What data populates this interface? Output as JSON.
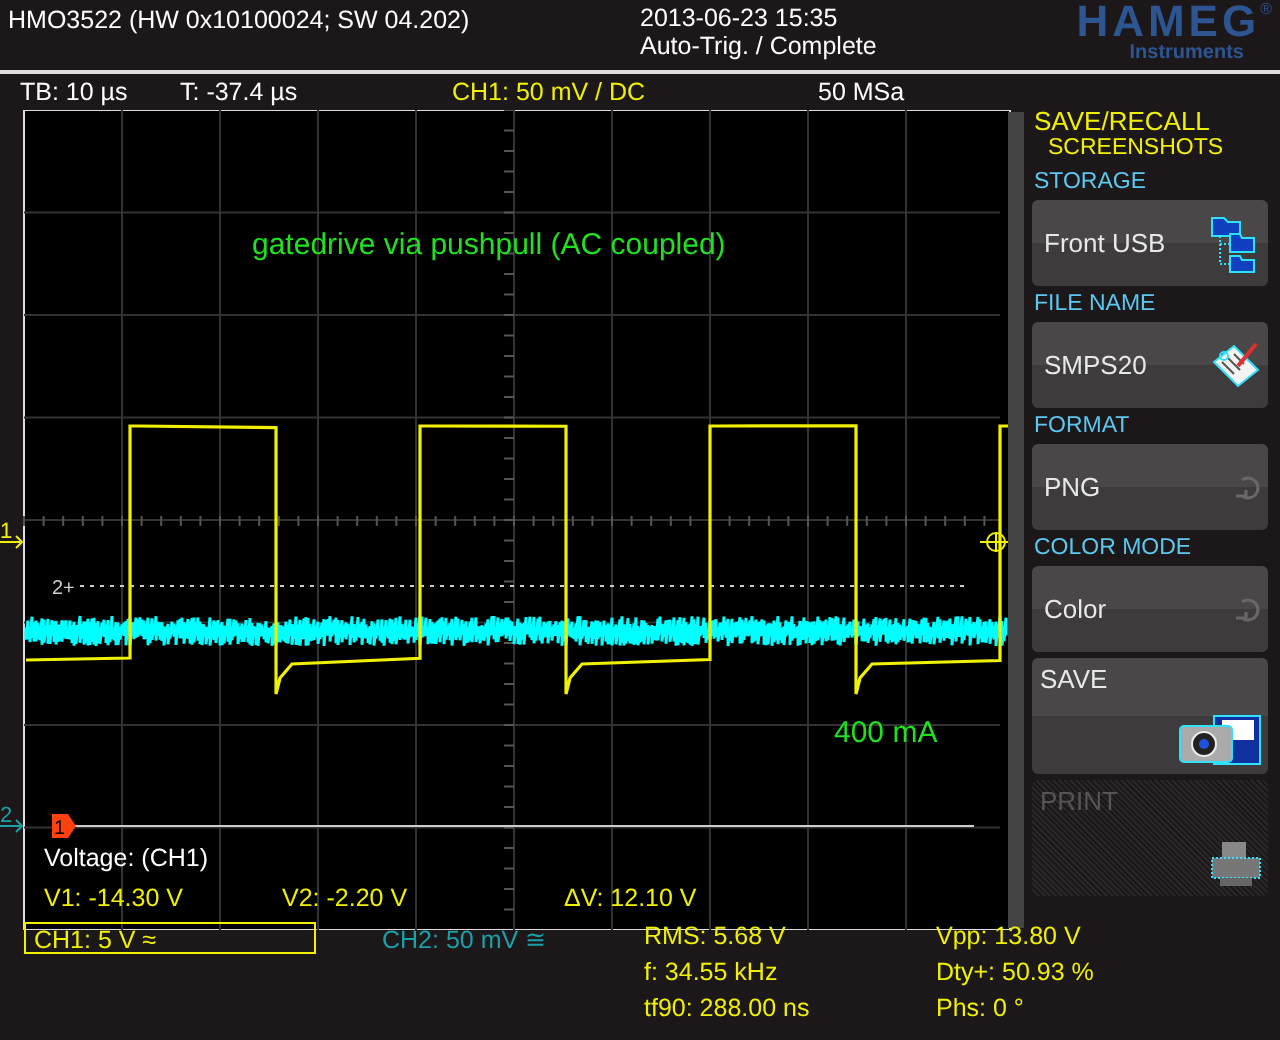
{
  "header": {
    "title": "HMO3522 (HW 0x10100024; SW 04.202)",
    "datetime": "2013-06-23 15:35",
    "status": "Auto-Trig. / Complete",
    "logo": "HAMEG",
    "logo_mark": "®",
    "logo_sub": "Instruments"
  },
  "settings_bar": [
    {
      "text": "TB: 10 µs",
      "kind": "plain"
    },
    {
      "text": "T: -37.4 µs",
      "kind": "plain"
    },
    {
      "text": "CH1: 50 mV / DC",
      "kind": "trigger"
    },
    {
      "text": "50 MSa",
      "kind": "plain"
    }
  ],
  "scope": {
    "channel_markers": [
      {
        "label": "1",
        "color": "#f0f000"
      },
      {
        "label": "2",
        "color": "#1aa0a8"
      }
    ],
    "reference_label": "2+",
    "annotations": [
      {
        "text": "gatedrive via pushpull (AC coupled)"
      },
      {
        "text": "400 mA"
      }
    ],
    "cursor_marker": "1",
    "cursor_readout": {
      "title": "Voltage: (CH1)",
      "values": [
        "V1: -14.30 V",
        "V2: -2.20 V",
        "ΔV: 12.10 V"
      ]
    }
  },
  "menu": {
    "title": "SAVE/RECALL",
    "subtitle": "SCREENSHOTS",
    "items": [
      {
        "heading": "STORAGE",
        "value": "Front USB",
        "kind": "folders"
      },
      {
        "heading": "FILE NAME",
        "value": "SMPS20",
        "kind": "notepad"
      },
      {
        "heading": "FORMAT",
        "value": "PNG",
        "kind": "cycle"
      },
      {
        "heading": "COLOR MODE",
        "value": "Color",
        "kind": "cycle"
      }
    ],
    "buttons": [
      {
        "label": "SAVE",
        "disabled": false
      },
      {
        "label": "PRINT",
        "disabled": true
      }
    ]
  },
  "channels": [
    {
      "label": "CH1: 5 V ≈",
      "color": "#f0f000",
      "selected": true
    },
    {
      "label": "CH2: 50 mV ≅",
      "color": "#1aa0a8",
      "selected": false
    }
  ],
  "measurements": [
    {
      "values": [
        "RMS: 5.68 V",
        "f: 34.55 kHz",
        "tf90: 288.00 ns"
      ]
    },
    {
      "values": [
        "Vpp: 13.80 V",
        "Dty+: 50.93 %",
        "Phs: 0 °"
      ]
    }
  ]
}
